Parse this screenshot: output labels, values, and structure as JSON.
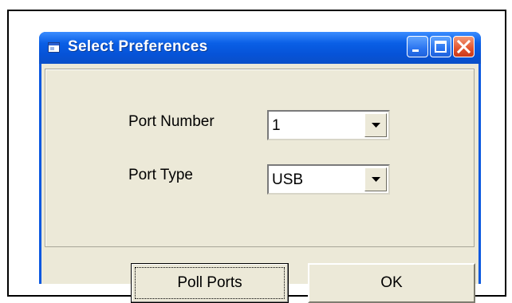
{
  "window": {
    "title": "Select Preferences",
    "icon": "window-app-icon",
    "controls": [
      "minimize-icon",
      "maximize-icon",
      "close-icon"
    ]
  },
  "form": {
    "port_number": {
      "label": "Port Number",
      "value": "1"
    },
    "port_type": {
      "label": "Port Type",
      "value": "USB"
    }
  },
  "buttons": {
    "poll_ports": "Poll Ports",
    "ok": "OK"
  },
  "colors": {
    "titlebar": "#0a58e0",
    "client": "#ece9d8",
    "close_button": "#e2532d"
  }
}
